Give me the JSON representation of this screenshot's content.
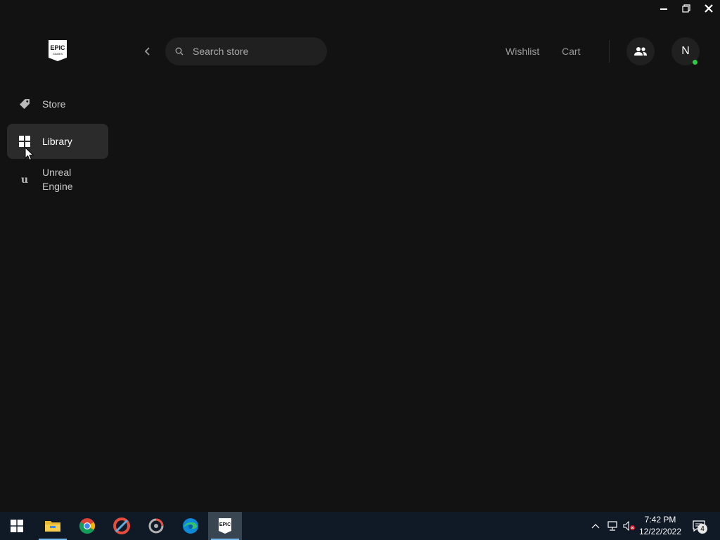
{
  "window": {
    "minimize_icon": "minimize-icon",
    "restore_icon": "restore-icon",
    "close_icon": "close-icon"
  },
  "logo": {
    "text_top": "EPIC",
    "text_bottom": "GAMES"
  },
  "sidebar": {
    "items": [
      {
        "label": "Store",
        "icon": "tag-icon",
        "active": false
      },
      {
        "label": "Library",
        "icon": "grid-icon",
        "active": true
      },
      {
        "label": "Unreal Engine",
        "icon": "unreal-icon",
        "active": false
      }
    ]
  },
  "header": {
    "search_placeholder": "Search store",
    "wishlist_label": "Wishlist",
    "cart_label": "Cart",
    "avatar_initial": "N",
    "presence_color": "#2ecc40"
  },
  "taskbar": {
    "apps": [
      "start",
      "file-explorer",
      "chrome",
      "ccleaner",
      "unknown-app",
      "edge",
      "epic-games"
    ],
    "time": "7:42 PM",
    "date": "12/22/2022",
    "notification_count": "4"
  },
  "colors": {
    "background": "#121212",
    "sidebar_active": "#2b2b2b",
    "taskbar": "#0f1a26"
  }
}
